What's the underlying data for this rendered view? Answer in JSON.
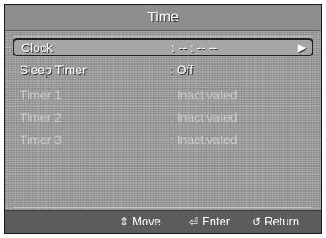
{
  "header": {
    "title": "Time"
  },
  "rows": [
    {
      "label": "Clock",
      "value": ": -- : -- --"
    },
    {
      "label": "Sleep Timer",
      "value": ": Off"
    },
    {
      "label": "Timer 1",
      "value": ": Inactivated"
    },
    {
      "label": "Timer 2",
      "value": ": Inactivated"
    },
    {
      "label": "Timer 3",
      "value": ": Inactivated"
    }
  ],
  "selected_row_arrow": "▶",
  "footer": {
    "move_icon": "⇕",
    "move_label": "Move",
    "enter_icon": "⏎",
    "enter_label": "Enter",
    "return_icon": "↺",
    "return_label": "Return"
  },
  "colors": {
    "panel_bg": "#9a9a9a",
    "header_bg": "#8e8e8e",
    "footer_bg": "#5c5c5c",
    "selected_border": "#222222"
  },
  "icons": [
    "right-arrow-icon",
    "move-icon",
    "enter-icon",
    "return-icon"
  ]
}
